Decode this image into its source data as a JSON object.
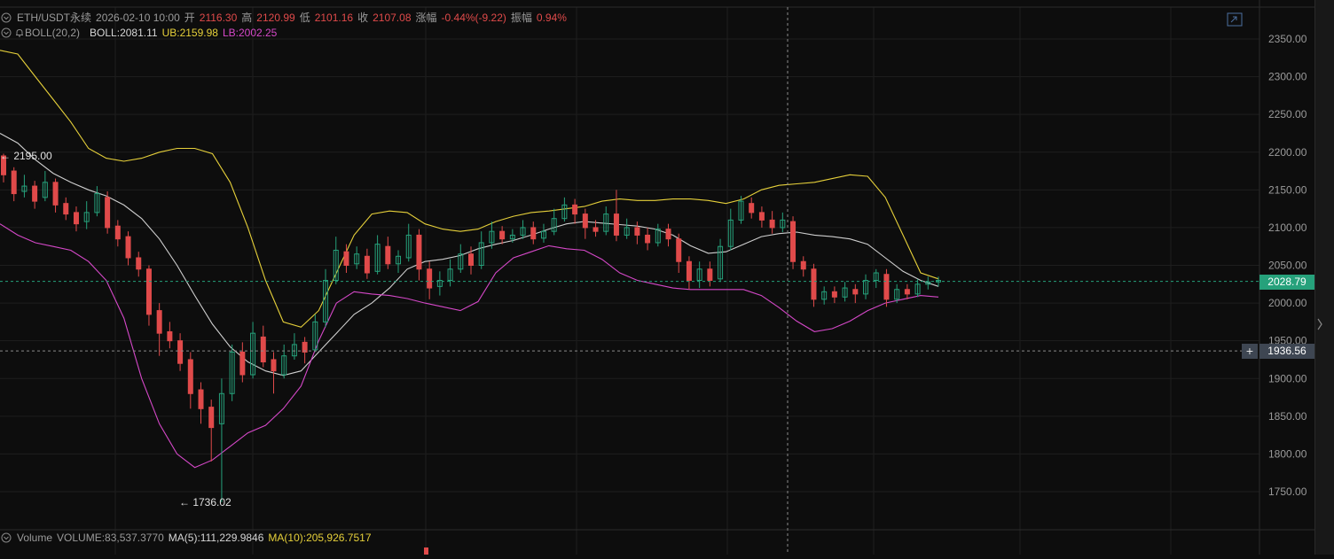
{
  "header": {
    "symbol": "ETH/USDT永续",
    "datetime": "2026-02-10 10:00",
    "open_label": "开",
    "open": "2116.30",
    "high_label": "高",
    "high": "2120.99",
    "low_label": "低",
    "low": "2101.16",
    "close_label": "收",
    "close": "2107.08",
    "change_label": "涨幅",
    "change": "-0.44%(-9.22)",
    "amp_label": "振幅",
    "amp": "0.94%"
  },
  "boll": {
    "name": "BOLL(20,2)",
    "mid": "BOLL:2081.11",
    "ub": "UB:2159.98",
    "lb": "LB:2002.25"
  },
  "volume": {
    "name": "Volume",
    "vol": "VOLUME:83,537.3770",
    "ma5": "MA(5):111,229.9846",
    "ma10": "MA(10):205,926.7517"
  },
  "price_tags": {
    "last": "2028.79",
    "crosshair": "1936.56"
  },
  "colors": {
    "up": "#26a17b",
    "down": "#e04a4a",
    "mid": "#cfcfcf",
    "upper": "#e6d03a",
    "lower": "#d548c8"
  },
  "chart_data": {
    "type": "candlestick",
    "y_ticks": [
      2350,
      2300,
      2250,
      2200,
      2150,
      2100,
      2050,
      2000,
      1950,
      1900,
      1850,
      1800,
      1750
    ],
    "y_tick_labels": [
      "2350.00",
      "2300.00",
      "2250.00",
      "2200.00",
      "2150.00",
      "2100.00",
      "2050.00",
      "2000.00",
      "1950.00",
      "1900.00",
      "1850.00",
      "1800.00",
      "1750.00"
    ],
    "annotations": {
      "high": {
        "label": "← 2195.00",
        "value": 2195.0
      },
      "low": {
        "label": "← 1736.02",
        "value": 1736.02
      }
    },
    "last_price": 2028.79,
    "crosshair_price": 1936.56,
    "bands": {
      "upper": [
        2335,
        2330,
        2300,
        2270,
        2240,
        2205,
        2192,
        2188,
        2192,
        2200,
        2205,
        2205,
        2198,
        2160,
        2100,
        2030,
        1975,
        1968,
        1990,
        2040,
        2090,
        2118,
        2122,
        2120,
        2105,
        2098,
        2095,
        2098,
        2108,
        2115,
        2120,
        2122,
        2125,
        2128,
        2135,
        2138,
        2136,
        2136,
        2138,
        2138,
        2136,
        2132,
        2138,
        2150,
        2156,
        2158,
        2160,
        2165,
        2170,
        2168,
        2140,
        2090,
        2040,
        2032
      ],
      "mid": [
        2225,
        2212,
        2190,
        2172,
        2160,
        2150,
        2142,
        2130,
        2112,
        2085,
        2050,
        2010,
        1972,
        1942,
        1922,
        1910,
        1904,
        1910,
        1935,
        1960,
        1985,
        2000,
        2020,
        2045,
        2055,
        2058,
        2063,
        2072,
        2078,
        2083,
        2090,
        2098,
        2105,
        2108,
        2106,
        2104,
        2102,
        2098,
        2090,
        2076,
        2066,
        2068,
        2078,
        2088,
        2092,
        2094,
        2090,
        2088,
        2085,
        2078,
        2060,
        2042,
        2030,
        2022
      ],
      "lower": [
        2105,
        2090,
        2080,
        2075,
        2070,
        2055,
        2030,
        1980,
        1900,
        1840,
        1800,
        1782,
        1792,
        1810,
        1828,
        1838,
        1860,
        1890,
        1950,
        2000,
        2015,
        2012,
        2010,
        2006,
        2000,
        1995,
        1990,
        2002,
        2040,
        2060,
        2068,
        2076,
        2072,
        2070,
        2058,
        2040,
        2030,
        2025,
        2020,
        2018,
        2018,
        2018,
        2018,
        2010,
        1994,
        1976,
        1962,
        1966,
        1976,
        1990,
        2000,
        2005,
        2010,
        2008
      ]
    },
    "candles": [
      [
        2195,
        2170,
        2198,
        2160
      ],
      [
        2175,
        2145,
        2180,
        2135
      ],
      [
        2148,
        2155,
        2170,
        2140
      ],
      [
        2155,
        2135,
        2162,
        2125
      ],
      [
        2140,
        2160,
        2175,
        2135
      ],
      [
        2160,
        2130,
        2165,
        2120
      ],
      [
        2132,
        2118,
        2140,
        2110
      ],
      [
        2120,
        2105,
        2128,
        2095
      ],
      [
        2108,
        2120,
        2135,
        2098
      ],
      [
        2120,
        2145,
        2155,
        2115
      ],
      [
        2140,
        2100,
        2148,
        2092
      ],
      [
        2102,
        2085,
        2110,
        2075
      ],
      [
        2088,
        2060,
        2095,
        2050
      ],
      [
        2060,
        2045,
        2068,
        2035
      ],
      [
        2045,
        1985,
        2050,
        1970
      ],
      [
        1990,
        1960,
        2000,
        1930
      ],
      [
        1962,
        1950,
        1975,
        1940
      ],
      [
        1950,
        1920,
        1960,
        1910
      ],
      [
        1925,
        1880,
        1935,
        1860
      ],
      [
        1885,
        1860,
        1895,
        1840
      ],
      [
        1862,
        1835,
        1872,
        1790
      ],
      [
        1840,
        1880,
        1900,
        1736
      ],
      [
        1880,
        1935,
        1945,
        1870
      ],
      [
        1935,
        1905,
        1948,
        1895
      ],
      [
        1905,
        1960,
        1975,
        1900
      ],
      [
        1955,
        1922,
        1970,
        1915
      ],
      [
        1925,
        1910,
        1935,
        1880
      ],
      [
        1905,
        1930,
        1945,
        1900
      ],
      [
        1930,
        1945,
        1960,
        1925
      ],
      [
        1948,
        1935,
        1955,
        1920
      ],
      [
        1938,
        1975,
        1985,
        1935
      ],
      [
        1975,
        2030,
        2045,
        1968
      ],
      [
        2030,
        2070,
        2088,
        2025
      ],
      [
        2068,
        2050,
        2078,
        2040
      ],
      [
        2052,
        2065,
        2075,
        2045
      ],
      [
        2062,
        2040,
        2072,
        2032
      ],
      [
        2042,
        2078,
        2090,
        2038
      ],
      [
        2075,
        2052,
        2088,
        2045
      ],
      [
        2052,
        2062,
        2070,
        2040
      ],
      [
        2060,
        2090,
        2105,
        2055
      ],
      [
        2090,
        2045,
        2098,
        2030
      ],
      [
        2045,
        2020,
        2055,
        2005
      ],
      [
        2022,
        2030,
        2042,
        2010
      ],
      [
        2030,
        2045,
        2058,
        2022
      ],
      [
        2045,
        2065,
        2078,
        2040
      ],
      [
        2065,
        2050,
        2075,
        2038
      ],
      [
        2050,
        2080,
        2095,
        2045
      ],
      [
        2080,
        2095,
        2108,
        2072
      ],
      [
        2095,
        2085,
        2102,
        2078
      ],
      [
        2085,
        2090,
        2098,
        2080
      ],
      [
        2090,
        2100,
        2110,
        2085
      ],
      [
        2100,
        2085,
        2108,
        2078
      ],
      [
        2086,
        2095,
        2105,
        2080
      ],
      [
        2095,
        2112,
        2125,
        2090
      ],
      [
        2112,
        2130,
        2140,
        2108
      ],
      [
        2130,
        2118,
        2138,
        2105
      ],
      [
        2118,
        2100,
        2125,
        2085
      ],
      [
        2100,
        2095,
        2110,
        2088
      ],
      [
        2095,
        2118,
        2128,
        2090
      ],
      [
        2118,
        2090,
        2150,
        2082
      ],
      [
        2090,
        2100,
        2112,
        2085
      ],
      [
        2100,
        2090,
        2108,
        2078
      ],
      [
        2090,
        2080,
        2100,
        2070
      ],
      [
        2080,
        2098,
        2105,
        2075
      ],
      [
        2098,
        2085,
        2105,
        2075
      ],
      [
        2085,
        2055,
        2092,
        2040
      ],
      [
        2055,
        2030,
        2062,
        2018
      ],
      [
        2030,
        2045,
        2055,
        2020
      ],
      [
        2045,
        2030,
        2055,
        2022
      ],
      [
        2032,
        2075,
        2085,
        2028
      ],
      [
        2075,
        2110,
        2125,
        2070
      ],
      [
        2110,
        2135,
        2142,
        2105
      ],
      [
        2132,
        2120,
        2140,
        2112
      ],
      [
        2120,
        2110,
        2128,
        2100
      ],
      [
        2110,
        2100,
        2122,
        2092
      ],
      [
        2100,
        2110,
        2120,
        2094
      ],
      [
        2108,
        2055,
        2115,
        2045
      ],
      [
        2055,
        2045,
        2062,
        2035
      ],
      [
        2045,
        2005,
        2052,
        1995
      ],
      [
        2005,
        2015,
        2022,
        1998
      ],
      [
        2015,
        2008,
        2022,
        2000
      ],
      [
        2008,
        2020,
        2028,
        2002
      ],
      [
        2018,
        2012,
        2025,
        2000
      ],
      [
        2012,
        2030,
        2038,
        2005
      ],
      [
        2030,
        2040,
        2045,
        2020
      ],
      [
        2038,
        2005,
        2045,
        1995
      ],
      [
        2005,
        2018,
        2025,
        2000
      ],
      [
        2018,
        2012,
        2025,
        2005
      ],
      [
        2012,
        2025,
        2032,
        2008
      ],
      [
        2025,
        2028,
        2035,
        2018
      ],
      [
        2028,
        2030,
        2035,
        2022
      ]
    ],
    "x_gridlines": 9,
    "volume_bar_visible": true
  }
}
